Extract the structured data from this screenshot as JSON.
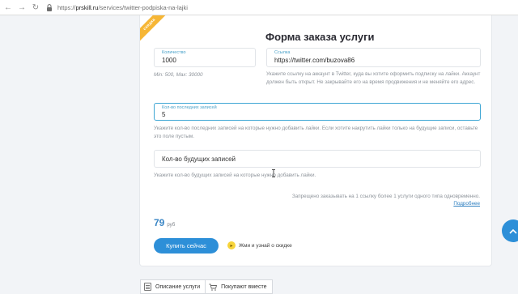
{
  "browser": {
    "secure_label": "https://",
    "host": "prskill.ru",
    "path": "/services/twitter-podpiska-na-lajki"
  },
  "form": {
    "ribbon": "скидка",
    "title": "Форма заказа услуги",
    "quantity": {
      "label": "Количество",
      "value": "1000",
      "hint": "Min: 500, Max: 30000"
    },
    "link": {
      "label": "Ссылка",
      "value": "https://twitter.com/buzova86",
      "hint": "Укажите ссылку на аккаунт в Twitter, куда вы хотите оформить подписку на лайки. Аккаунт должен быть открыт. Не закрывайте его на время продвижения и не меняйте его адрес."
    },
    "last_posts": {
      "label": "Кол-во последних записей",
      "value": "5",
      "hint": "Укажите кол-во последних записей на которые нужно добавить лайки. Если хотите накрутить лайки только на будущие записи, оставьте это поле пустым."
    },
    "future_posts": {
      "placeholder": "Кол-во будущих записей",
      "hint": "Укажите кол-во будущих записей на которые нужно добавить лайки."
    },
    "legal_note": "Запрещено заказывать на 1 ссылку более 1 услуги одного типа одновременно.",
    "more_link": "Подробнее",
    "price": {
      "value": "79",
      "currency": "руб"
    },
    "buy_button": "Купить сейчас",
    "discount_text": "Жми и узнай о скидке"
  },
  "tabs": [
    {
      "label": "Описание услуги"
    },
    {
      "label": "Покупают вместе"
    }
  ],
  "colors": {
    "accent": "#2d8fd8",
    "link": "#2e7fc0",
    "label": "#4aa2c9",
    "ribbon": "#f6b635",
    "discount": "#f7d43a"
  },
  "icons": {
    "back": "arrow-left-icon",
    "forward": "arrow-right-icon",
    "reload": "reload-icon",
    "lock": "lock-icon",
    "tab1": "document-icon",
    "tab2": "cart-icon",
    "scroll": "chevron-up-icon"
  }
}
